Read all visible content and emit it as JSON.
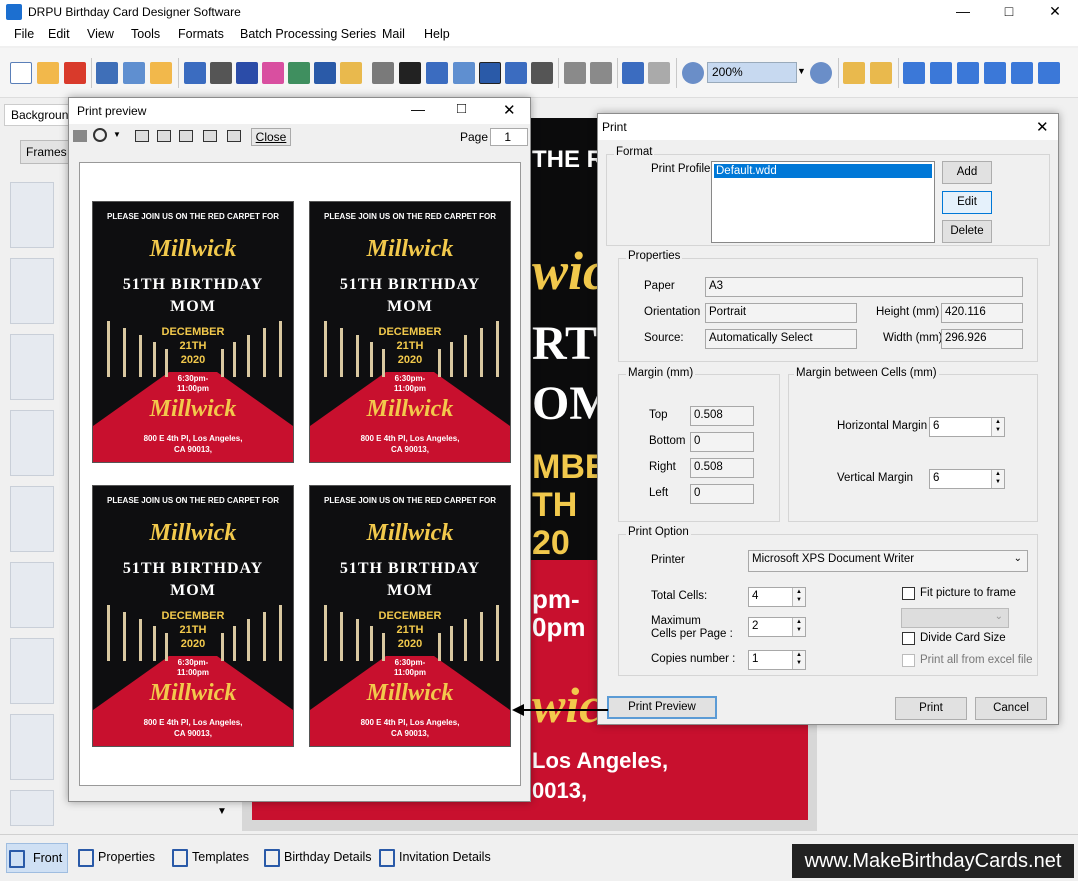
{
  "window": {
    "title": "DRPU Birthday Card Designer Software",
    "min": "—",
    "max": "□",
    "close": "✕"
  },
  "menu": [
    "File",
    "Edit",
    "View",
    "Tools",
    "Formats",
    "Batch Processing Series",
    "Mail",
    "Help"
  ],
  "toolbar": {
    "zoom_value": "200%"
  },
  "left_panel": {
    "tab_label": "Background",
    "frames_label": "Frames"
  },
  "card_canvas": {
    "top_text": "THE RE",
    "frag_name": "wic",
    "frag_bday": "RT",
    "frag_mom": "OM",
    "frag_date": "MBE",
    "frag_day": "TH",
    "frag_year": "20",
    "frag_time1": "pm-",
    "frag_time2": "0pm",
    "frag_name2": "wic",
    "frag_addr1": "Los Angeles,",
    "frag_addr2": "0013,"
  },
  "print_preview": {
    "title": "Print preview",
    "close_label": "Close",
    "page_label": "Page",
    "page_value": "1",
    "card": {
      "top": "PLEASE JOIN US ON THE RED  CARPET FOR",
      "name": "Millwick",
      "bday": "51TH BIRTHDAY",
      "mom": "MOM",
      "date1": "DECEMBER",
      "date2": "21TH",
      "date3": "2020",
      "time1": "6:30pm-",
      "time2": "11:00pm",
      "name2": "Millwick",
      "addr1": "800 E 4th Pl, Los Angeles,",
      "addr2": "CA 90013,"
    }
  },
  "print_dialog": {
    "title": "Print",
    "format_label": "Format",
    "print_profile_label": "Print Profile",
    "profile_selected": "Default.wdd",
    "add_button": "Add",
    "edit_button": "Edit",
    "delete_button": "Delete",
    "properties_label": "Properties",
    "paper_label": "Paper",
    "paper_value": "A3",
    "orientation_label": "Orientation",
    "orientation_value": "Portrait",
    "source_label": "Source:",
    "source_value": "Automatically Select",
    "height_label": "Height (mm)",
    "height_value": "420.116",
    "width_label": "Width (mm)",
    "width_value": "296.926",
    "margin_label": "Margin (mm)",
    "top_label": "Top",
    "top_value": "0.508",
    "bottom_label": "Bottom",
    "bottom_value": "0",
    "right_label": "Right",
    "right_value": "0.508",
    "left_label": "Left",
    "left_value": "0",
    "cells_margin_label": "Margin between Cells (mm)",
    "h_margin_label": "Horizontal Margin",
    "h_margin_value": "6",
    "v_margin_label": "Vertical Margin",
    "v_margin_value": "6",
    "print_option_label": "Print Option",
    "printer_label": "Printer",
    "printer_value": "Microsoft XPS Document Writer",
    "total_cells_label": "Total Cells:",
    "total_cells_value": "4",
    "max_cells_label1": "Maximum",
    "max_cells_label2": "Cells per Page :",
    "max_cells_value": "2",
    "copies_label": "Copies number :",
    "copies_value": "1",
    "fit_picture_label": "Fit picture to frame",
    "divide_card_label": "Divide Card Size",
    "print_all_label": "Print all from excel file",
    "print_preview_button": "Print Preview",
    "print_button": "Print",
    "cancel_button": "Cancel"
  },
  "bottom_tabs": [
    "Front",
    "Properties",
    "Templates",
    "Birthday Details",
    "Invitation Details"
  ],
  "watermark": "www.MakeBirthdayCards.net"
}
